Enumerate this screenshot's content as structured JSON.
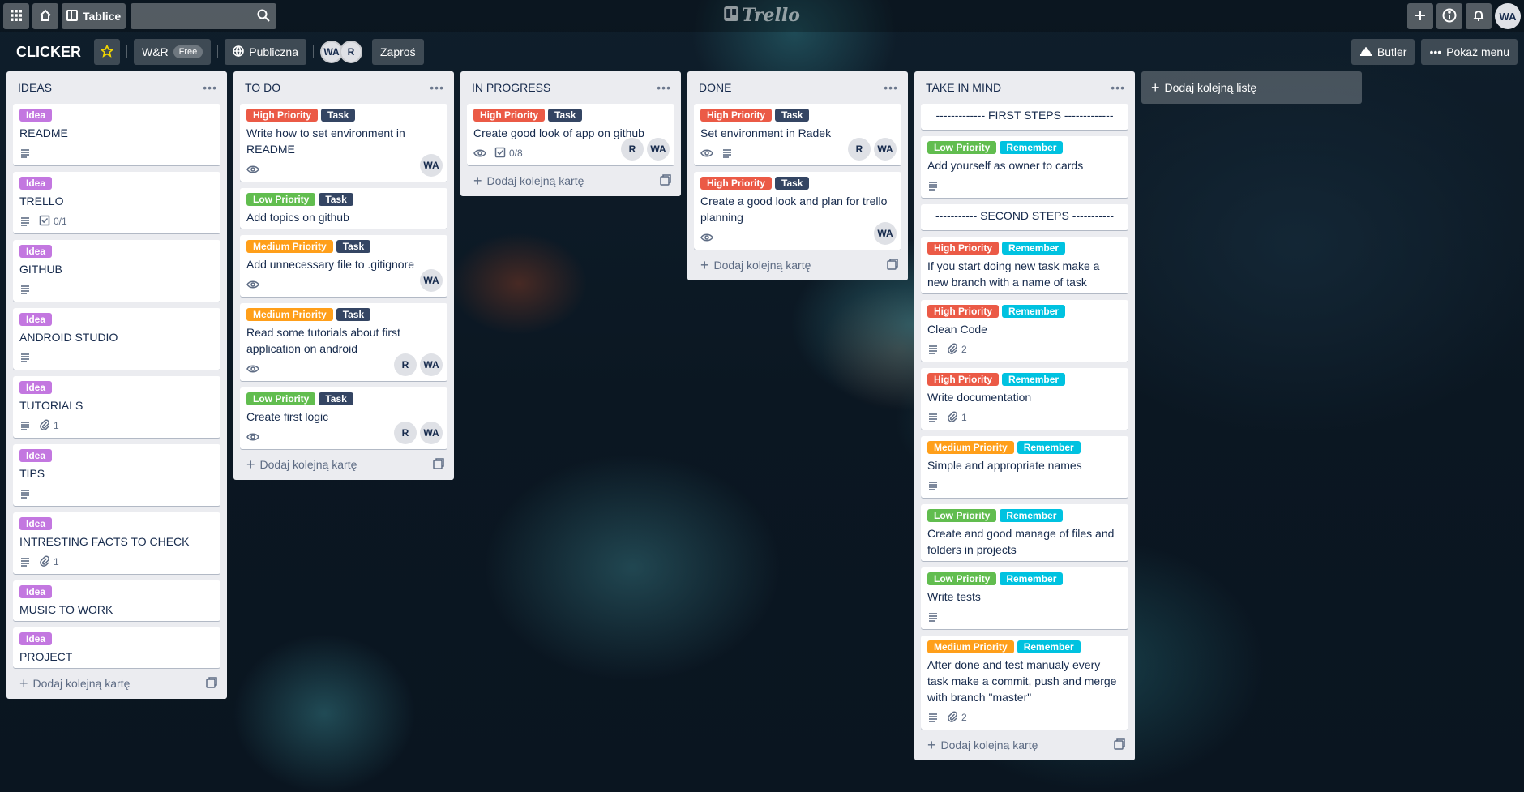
{
  "top_header": {
    "boards_label": "Tablice",
    "logo_text": "Trello",
    "user_initials": "WA"
  },
  "board_header": {
    "title": "CLICKER",
    "team_name": "W&R",
    "team_plan": "Free",
    "visibility": "Publiczna",
    "members": [
      "WA",
      "R"
    ],
    "invite_label": "Zaproś",
    "butler_label": "Butler",
    "menu_label": "Pokaż menu"
  },
  "colors": {
    "idea": "#c377e0",
    "high": "#eb5a46",
    "medium": "#ff9f1a",
    "low": "#61bd4f",
    "task": "#344563",
    "remember": "#00c2e0"
  },
  "add_card_label": "Dodaj kolejną kartę",
  "add_list_label": "Dodaj kolejną listę",
  "lists": [
    {
      "title": "IDEAS",
      "cards": [
        {
          "labels": [
            {
              "text": "Idea",
              "color": "idea"
            }
          ],
          "title": "README",
          "badges": {
            "desc": true
          }
        },
        {
          "labels": [
            {
              "text": "Idea",
              "color": "idea"
            }
          ],
          "title": "TRELLO",
          "badges": {
            "desc": true,
            "checklist": "0/1"
          }
        },
        {
          "labels": [
            {
              "text": "Idea",
              "color": "idea"
            }
          ],
          "title": "GITHUB",
          "badges": {
            "desc": true
          }
        },
        {
          "labels": [
            {
              "text": "Idea",
              "color": "idea"
            }
          ],
          "title": "ANDROID STUDIO",
          "badges": {
            "desc": true
          }
        },
        {
          "labels": [
            {
              "text": "Idea",
              "color": "idea"
            }
          ],
          "title": "TUTORIALS",
          "badges": {
            "desc": true,
            "attach": "1"
          }
        },
        {
          "labels": [
            {
              "text": "Idea",
              "color": "idea"
            }
          ],
          "title": "TIPS",
          "badges": {
            "desc": true
          }
        },
        {
          "labels": [
            {
              "text": "Idea",
              "color": "idea"
            }
          ],
          "title": "INTRESTING FACTS TO CHECK",
          "badges": {
            "desc": true,
            "attach": "1"
          }
        },
        {
          "labels": [
            {
              "text": "Idea",
              "color": "idea"
            }
          ],
          "title": "MUSIC TO WORK"
        },
        {
          "labels": [
            {
              "text": "Idea",
              "color": "idea"
            }
          ],
          "title": "PROJECT"
        }
      ]
    },
    {
      "title": "TO DO",
      "cards": [
        {
          "labels": [
            {
              "text": "High Priority",
              "color": "high"
            },
            {
              "text": "Task",
              "color": "task"
            }
          ],
          "title": "Write how to set environment in README",
          "badges": {
            "watch": true
          },
          "members": [
            "WA"
          ]
        },
        {
          "labels": [
            {
              "text": "Low Priority",
              "color": "low"
            },
            {
              "text": "Task",
              "color": "task"
            }
          ],
          "title": "Add topics on github"
        },
        {
          "labels": [
            {
              "text": "Medium Priority",
              "color": "medium"
            },
            {
              "text": "Task",
              "color": "task"
            }
          ],
          "title": "Add unnecessary file to .gitignore",
          "badges": {
            "watch": true
          },
          "members": [
            "WA"
          ]
        },
        {
          "labels": [
            {
              "text": "Medium Priority",
              "color": "medium"
            },
            {
              "text": "Task",
              "color": "task"
            }
          ],
          "title": "Read some tutorials about first application on android",
          "badges": {
            "watch": true
          },
          "members": [
            "R",
            "WA"
          ]
        },
        {
          "labels": [
            {
              "text": "Low Priority",
              "color": "low"
            },
            {
              "text": "Task",
              "color": "task"
            }
          ],
          "title": "Create first logic",
          "badges": {
            "watch": true
          },
          "members": [
            "R",
            "WA"
          ]
        }
      ]
    },
    {
      "title": "IN PROGRESS",
      "cards": [
        {
          "labels": [
            {
              "text": "High Priority",
              "color": "high"
            },
            {
              "text": "Task",
              "color": "task"
            }
          ],
          "title": "Create good look of app on github",
          "badges": {
            "watch": true,
            "checklist": "0/8"
          },
          "members": [
            "R",
            "WA"
          ]
        }
      ]
    },
    {
      "title": "DONE",
      "cards": [
        {
          "labels": [
            {
              "text": "High Priority",
              "color": "high"
            },
            {
              "text": "Task",
              "color": "task"
            }
          ],
          "title": "Set environment in Radek",
          "badges": {
            "watch": true,
            "desc": true
          },
          "members": [
            "R",
            "WA"
          ]
        },
        {
          "labels": [
            {
              "text": "High Priority",
              "color": "high"
            },
            {
              "text": "Task",
              "color": "task"
            }
          ],
          "title": "Create a good look and plan for trello planning",
          "badges": {
            "watch": true
          },
          "members": [
            "WA"
          ]
        }
      ]
    },
    {
      "title": "TAKE IN MIND",
      "cards": [
        {
          "separator": "------------- FIRST STEPS -------------"
        },
        {
          "labels": [
            {
              "text": "Low Priority",
              "color": "low"
            },
            {
              "text": "Remember",
              "color": "remember"
            }
          ],
          "title": "Add yourself as owner to cards",
          "badges": {
            "desc": true
          }
        },
        {
          "separator": "----------- SECOND STEPS -----------"
        },
        {
          "labels": [
            {
              "text": "High Priority",
              "color": "high"
            },
            {
              "text": "Remember",
              "color": "remember"
            }
          ],
          "title": "If you start doing new task make a new branch with a name of task"
        },
        {
          "labels": [
            {
              "text": "High Priority",
              "color": "high"
            },
            {
              "text": "Remember",
              "color": "remember"
            }
          ],
          "title": "Clean Code",
          "badges": {
            "desc": true,
            "attach": "2"
          }
        },
        {
          "labels": [
            {
              "text": "High Priority",
              "color": "high"
            },
            {
              "text": "Remember",
              "color": "remember"
            }
          ],
          "title": "Write documentation",
          "badges": {
            "desc": true,
            "attach": "1"
          }
        },
        {
          "labels": [
            {
              "text": "Medium Priority",
              "color": "medium"
            },
            {
              "text": "Remember",
              "color": "remember"
            }
          ],
          "title": "Simple and appropriate names",
          "badges": {
            "desc": true
          }
        },
        {
          "labels": [
            {
              "text": "Low Priority",
              "color": "low"
            },
            {
              "text": "Remember",
              "color": "remember"
            }
          ],
          "title": "Create and good manage of files and folders in projects"
        },
        {
          "labels": [
            {
              "text": "Low Priority",
              "color": "low"
            },
            {
              "text": "Remember",
              "color": "remember"
            }
          ],
          "title": "Write tests",
          "badges": {
            "desc": true
          }
        },
        {
          "labels": [
            {
              "text": "Medium Priority",
              "color": "medium"
            },
            {
              "text": "Remember",
              "color": "remember"
            }
          ],
          "title": "After done and test manualy every task make a commit, push and merge with branch \"master\"",
          "badges": {
            "desc": true,
            "attach": "2"
          }
        }
      ]
    }
  ]
}
